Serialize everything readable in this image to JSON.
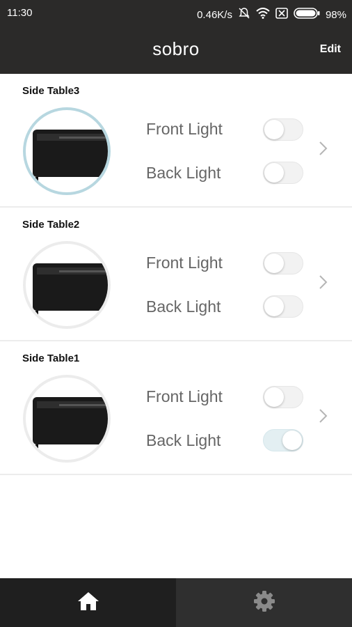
{
  "status_bar": {
    "time": "11:30",
    "speed": "0.46K/s",
    "battery": "98%"
  },
  "app_bar": {
    "title": "sobro",
    "edit_label": "Edit"
  },
  "devices": [
    {
      "name": "Side Table3",
      "front_label": "Front Light",
      "back_label": "Back Light",
      "front_on": false,
      "back_on": false
    },
    {
      "name": "Side Table2",
      "front_label": "Front Light",
      "back_label": "Back Light",
      "front_on": false,
      "back_on": false
    },
    {
      "name": "Side Table1",
      "front_label": "Front Light",
      "back_label": "Back Light",
      "front_on": false,
      "back_on": true
    }
  ],
  "tab_bar": {
    "items": [
      {
        "icon": "home-icon",
        "active": true
      },
      {
        "icon": "gear-icon",
        "active": false
      }
    ]
  },
  "colors": {
    "bar_bg": "#2b2a29",
    "active_ring": "#b7d7e0",
    "toggle_on": "#e3eff2"
  }
}
